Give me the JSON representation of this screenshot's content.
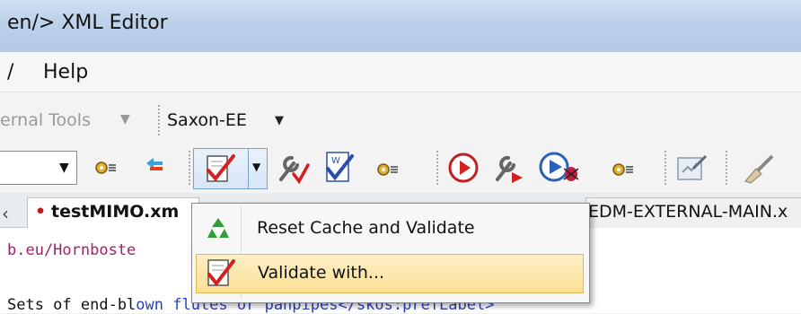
{
  "window": {
    "title": "en/> XML Editor"
  },
  "menubar": {
    "items": [
      {
        "label": "/"
      },
      {
        "label": "Help"
      }
    ]
  },
  "toolbar1": {
    "external_tools_label": "ernal Tools",
    "saxon_label": "Saxon-EE"
  },
  "tabs": [
    {
      "label": "testMIMO.xm",
      "modified_marker": "•"
    },
    {
      "label": "EDM-EXTERNAL-MAIN.x"
    }
  ],
  "tab_left_arrow": "‹",
  "dropdown_menu": {
    "items": [
      {
        "label": "Reset Cache and Validate",
        "icon": "recycle-icon"
      },
      {
        "label": "Validate with...",
        "icon": "validate-with-icon",
        "selected": true
      }
    ]
  },
  "editor": {
    "lines": [
      {
        "text": "b.eu/Hornboste"
      },
      {
        "text_black": "Sets of end-bl",
        "text_blue": "own flutes or panpipes</skos:prefLabel>"
      }
    ]
  },
  "colors": {
    "accent_red": "#d42020",
    "tag_blue": "#2b3fbf",
    "menu_highlight": "#fbdf92"
  }
}
